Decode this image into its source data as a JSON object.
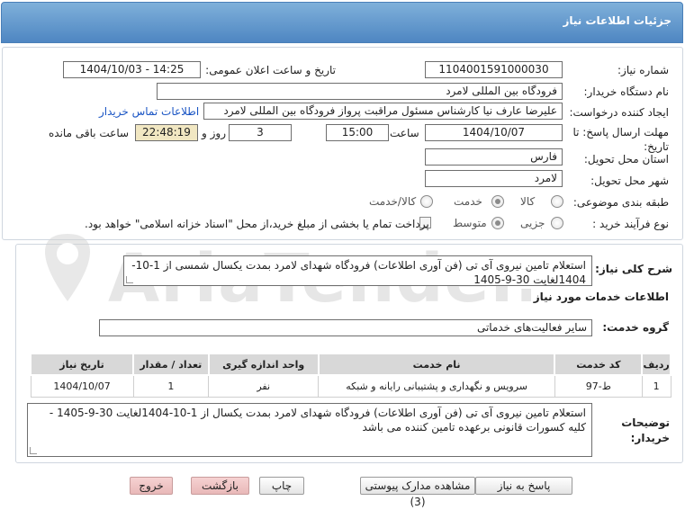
{
  "header": {
    "title": "جزئیات اطلاعات نیاز"
  },
  "form": {
    "need_number_label": "شماره نیاز:",
    "need_number": "1104001591000030",
    "announce_label": "تاریخ و ساعت اعلان عمومی:",
    "announce_value": "1404/10/03 - 14:25",
    "buyer_org_label": "نام دستگاه خریدار:",
    "buyer_org": "فرودگاه بین المللی لامرد",
    "creator_label": "ایجاد کننده درخواست:",
    "creator": "علیرضا عارف نیا کارشناس مسئول مراقبت پرواز فرودگاه بین المللی لامرد",
    "contact_link": "اطلاعات تماس خریدار",
    "deadline_label": "مهلت ارسال پاسخ: تا تاریخ:",
    "deadline_date": "1404/10/07",
    "time_label": "ساعت",
    "deadline_time": "15:00",
    "days_value": "3",
    "days_label": "روز و",
    "remaining_time": "22:48:19",
    "remaining_label": "ساعت باقی مانده",
    "province_label": "استان محل تحویل:",
    "province": "فارس",
    "city_label": "شهر محل تحویل:",
    "city": "لامرد",
    "category_label": "طبقه بندی موضوعی:",
    "category_options": [
      "کالا",
      "خدمت",
      "کالا/خدمت"
    ],
    "category_selected": "خدمت",
    "process_label": "نوع فرآیند خرید :",
    "process_options": [
      "جزیی",
      "متوسط"
    ],
    "process_selected": "متوسط",
    "payment_text": "پرداخت تمام یا بخشی از مبلغ خرید،از محل \"اسناد خزانه اسلامی\" خواهد بود."
  },
  "details": {
    "summary_label": "شرح کلی نیاز:",
    "summary": "استعلام  تامین نیروی  آی تی (فن آوری اطلاعات) فرودگاه شهدای لامرد بمدت یکسال شمسی از 1-10-1404لغایت 30-9-1405",
    "services_heading": "اطلاعات خدمات مورد نیاز",
    "service_group_label": "گروه خدمت:",
    "service_group": "سایر فعالیت‌های خدماتی",
    "table": {
      "headers": [
        "ردیف",
        "کد خدمت",
        "نام خدمت",
        "واحد اندازه گیری",
        "تعداد / مقدار",
        "تاریخ نیاز"
      ],
      "rows": [
        [
          "1",
          "ط-97",
          "سرویس و نگهداری و پشتیبانی رایانه و شبکه",
          "نفر",
          "1",
          "1404/10/07"
        ]
      ]
    },
    "buyer_notes_label": "توضیحات خریدار:",
    "buyer_notes": "استعلام  تامین نیروی  آی تی (فن آوری اطلاعات) فرودگاه شهدای لامرد بمدت یکسال از 1-10-1404لغایت 30-9-1405 - کلیه کسورات قانونی برعهده تامین کننده می باشد"
  },
  "buttons": {
    "reply": "پاسخ به نیاز",
    "attachments": "مشاهده مدارک پیوستی (3)",
    "print": "چاپ",
    "back": "بازگشت",
    "exit": "خروج"
  },
  "watermark": "AriaTender.net"
}
